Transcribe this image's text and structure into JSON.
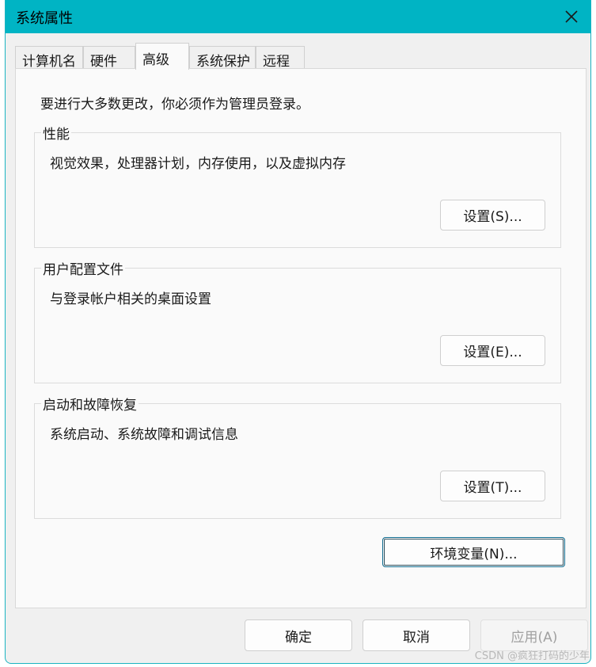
{
  "window": {
    "title": "系统属性"
  },
  "tabs": [
    {
      "label": "计算机名"
    },
    {
      "label": "硬件"
    },
    {
      "label": "高级"
    },
    {
      "label": "系统保护"
    },
    {
      "label": "远程"
    }
  ],
  "admin_note": "要进行大多数更改，你必须作为管理员登录。",
  "groups": [
    {
      "label": "性能",
      "desc": "视觉效果，处理器计划，内存使用，以及虚拟内存",
      "button": "设置(S)..."
    },
    {
      "label": "用户配置文件",
      "desc": "与登录帐户相关的桌面设置",
      "button": "设置(E)..."
    },
    {
      "label": "启动和故障恢复",
      "desc": "系统启动、系统故障和调试信息",
      "button": "设置(T)..."
    }
  ],
  "env_button": "环境变量(N)...",
  "footer": {
    "ok": "确定",
    "cancel": "取消",
    "apply": "应用(A)"
  },
  "watermark": "CSDN @疯狂打码的少年",
  "colors": {
    "titlebar": "#00b4c4",
    "panel": "#fafafa"
  }
}
